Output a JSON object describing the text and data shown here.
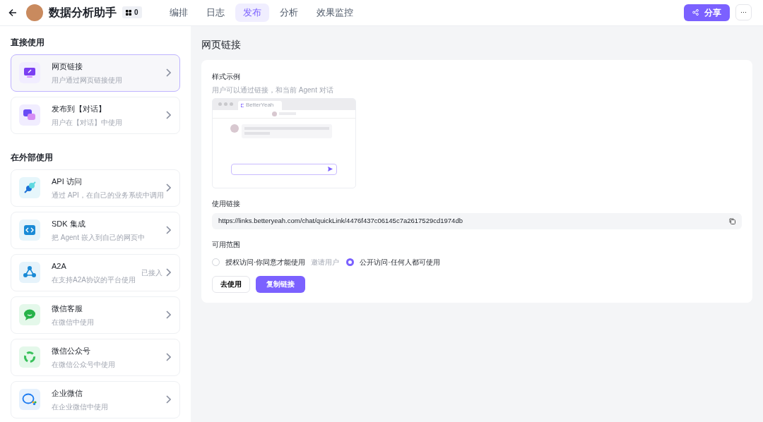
{
  "header": {
    "title": "数据分析助手",
    "badge_count": "0",
    "tabs": [
      {
        "label": "编排",
        "selected": false
      },
      {
        "label": "日志",
        "selected": false
      },
      {
        "label": "发布",
        "selected": true
      },
      {
        "label": "分析",
        "selected": false
      },
      {
        "label": "效果监控",
        "selected": false
      }
    ],
    "share_button": "分享",
    "more_button": "···"
  },
  "sidebar": {
    "sections": [
      {
        "title": "直接使用",
        "items": [
          {
            "kind": "link",
            "title": "网页链接",
            "subtitle": "用户通过网页链接使用",
            "selected": true
          },
          {
            "kind": "chat",
            "title": "发布到【对话】",
            "subtitle": "用户在【对话】中使用",
            "selected": false
          }
        ]
      },
      {
        "title": "在外部使用",
        "items": [
          {
            "kind": "api",
            "title": "API 访问",
            "subtitle": "通过 API，在自己的业务系统中调用",
            "selected": false
          },
          {
            "kind": "sdk",
            "title": "SDK 集成",
            "subtitle": "把 Agent 嵌入到自己的网页中",
            "selected": false
          },
          {
            "kind": "a2a",
            "title": "A2A",
            "subtitle": "在支持A2A协议的平台使用",
            "status": "已接入",
            "selected": false
          },
          {
            "kind": "wechat",
            "title": "微信客服",
            "subtitle": "在微信中使用",
            "selected": false
          },
          {
            "kind": "official",
            "title": "微信公众号",
            "subtitle": "在微信公众号中使用",
            "selected": false
          },
          {
            "kind": "wecom",
            "title": "企业微信",
            "subtitle": "在企业微信中使用",
            "selected": false
          }
        ]
      }
    ]
  },
  "main": {
    "title": "网页链接",
    "preview": {
      "label": "样式示例",
      "description": "用户可以通过链接，和当前 Agent 对话",
      "tab_title": "BetterYeah"
    },
    "link": {
      "label": "使用链接",
      "url": "https://links.betteryeah.com/chat/quickLink/4476f437c06145c7a2617529cd1974db"
    },
    "scope": {
      "label": "可用范围",
      "options": [
        {
          "label": "授权访问·你同意才能使用",
          "extra": "邀请用户",
          "selected": false
        },
        {
          "label": "公开访问·任何人都可使用",
          "selected": true
        }
      ]
    },
    "buttons": [
      {
        "kind": "secondary",
        "label": "去使用"
      },
      {
        "kind": "primary",
        "label": "复制链接"
      }
    ]
  }
}
